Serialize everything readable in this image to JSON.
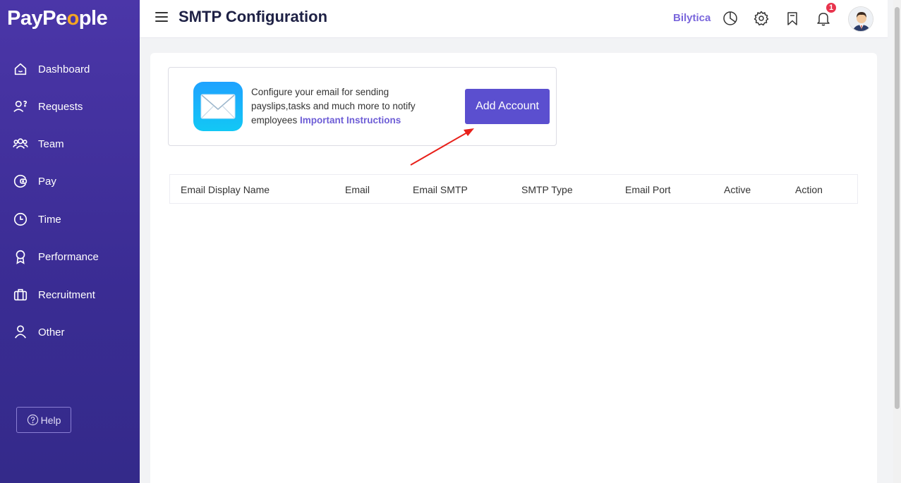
{
  "app": {
    "logo_prefix": "PayPe",
    "logo_o": "o",
    "logo_suffix": "ple"
  },
  "sidebar": {
    "items": [
      {
        "label": "Dashboard",
        "icon": "home-icon"
      },
      {
        "label": "Requests",
        "icon": "requests-icon"
      },
      {
        "label": "Team",
        "icon": "team-icon"
      },
      {
        "label": "Pay",
        "icon": "wallet-icon"
      },
      {
        "label": "Time",
        "icon": "clock-icon"
      },
      {
        "label": "Performance",
        "icon": "award-icon"
      },
      {
        "label": "Recruitment",
        "icon": "briefcase-icon"
      },
      {
        "label": "Other",
        "icon": "user-icon"
      }
    ],
    "help_label": "Help"
  },
  "header": {
    "title": "SMTP Configuration",
    "company": "Bilytica",
    "notification_count": "1"
  },
  "info_box": {
    "text": "Configure your email for sending payslips,tasks and much more to notify employees ",
    "link": "Important Instructions",
    "button": "Add Account"
  },
  "table": {
    "columns": [
      "Email Display Name",
      "Email",
      "Email SMTP",
      "SMTP Type",
      "Email Port",
      "Active",
      "Action"
    ]
  },
  "colors": {
    "sidebar": "#4b36a8",
    "accent": "#5b4fcf",
    "link": "#6d5dd6",
    "badge": "#e8344d",
    "arrow": "#e8201a"
  }
}
